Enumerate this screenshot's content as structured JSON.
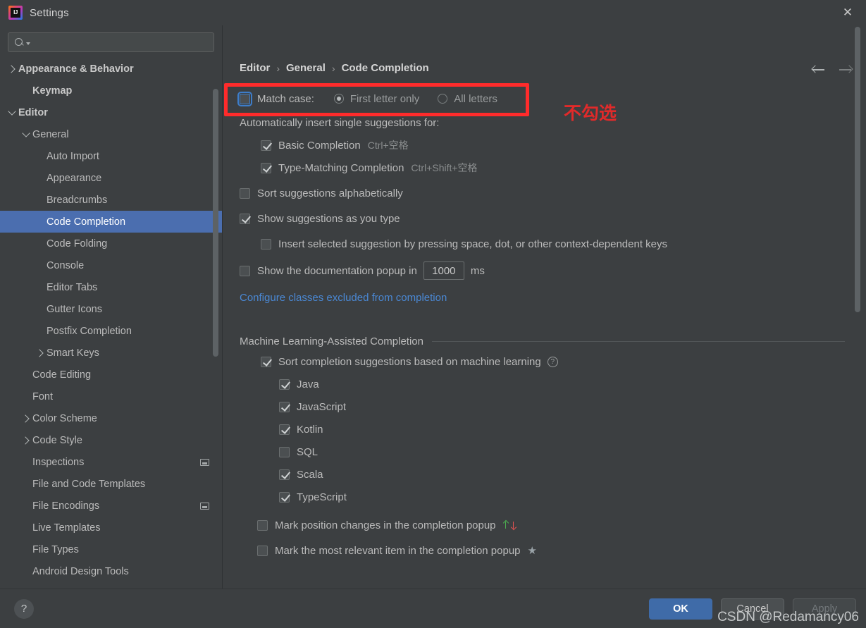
{
  "window": {
    "title": "Settings",
    "logo_icon": "intellij-idea-logo",
    "close_icon": "close-icon"
  },
  "sidebar": {
    "search": {
      "placeholder": "",
      "value": "",
      "icon": "search-icon",
      "caret_icon": "chevron-down-icon"
    },
    "items": [
      {
        "label": "Appearance & Behavior",
        "depth": 0,
        "twisty": "right",
        "bold": true,
        "selected": false,
        "trailing": false
      },
      {
        "label": "Keymap",
        "depth": 1,
        "twisty": "none",
        "bold": true,
        "selected": false,
        "trailing": false
      },
      {
        "label": "Editor",
        "depth": 0,
        "twisty": "down",
        "bold": true,
        "selected": false,
        "trailing": false
      },
      {
        "label": "General",
        "depth": 1,
        "twisty": "down",
        "bold": false,
        "selected": false,
        "trailing": false
      },
      {
        "label": "Auto Import",
        "depth": 2,
        "twisty": "none",
        "bold": false,
        "selected": false,
        "trailing": false
      },
      {
        "label": "Appearance",
        "depth": 2,
        "twisty": "none",
        "bold": false,
        "selected": false,
        "trailing": false
      },
      {
        "label": "Breadcrumbs",
        "depth": 2,
        "twisty": "none",
        "bold": false,
        "selected": false,
        "trailing": false
      },
      {
        "label": "Code Completion",
        "depth": 2,
        "twisty": "none",
        "bold": false,
        "selected": true,
        "trailing": false
      },
      {
        "label": "Code Folding",
        "depth": 2,
        "twisty": "none",
        "bold": false,
        "selected": false,
        "trailing": false
      },
      {
        "label": "Console",
        "depth": 2,
        "twisty": "none",
        "bold": false,
        "selected": false,
        "trailing": false
      },
      {
        "label": "Editor Tabs",
        "depth": 2,
        "twisty": "none",
        "bold": false,
        "selected": false,
        "trailing": false
      },
      {
        "label": "Gutter Icons",
        "depth": 2,
        "twisty": "none",
        "bold": false,
        "selected": false,
        "trailing": false
      },
      {
        "label": "Postfix Completion",
        "depth": 2,
        "twisty": "none",
        "bold": false,
        "selected": false,
        "trailing": false
      },
      {
        "label": "Smart Keys",
        "depth": 2,
        "twisty": "right",
        "bold": false,
        "selected": false,
        "trailing": false
      },
      {
        "label": "Code Editing",
        "depth": 1,
        "twisty": "none",
        "bold": false,
        "selected": false,
        "trailing": false
      },
      {
        "label": "Font",
        "depth": 1,
        "twisty": "none",
        "bold": false,
        "selected": false,
        "trailing": false
      },
      {
        "label": "Color Scheme",
        "depth": 1,
        "twisty": "right",
        "bold": false,
        "selected": false,
        "trailing": false
      },
      {
        "label": "Code Style",
        "depth": 1,
        "twisty": "right",
        "bold": false,
        "selected": false,
        "trailing": false
      },
      {
        "label": "Inspections",
        "depth": 1,
        "twisty": "none",
        "bold": false,
        "selected": false,
        "trailing": true
      },
      {
        "label": "File and Code Templates",
        "depth": 1,
        "twisty": "none",
        "bold": false,
        "selected": false,
        "trailing": false
      },
      {
        "label": "File Encodings",
        "depth": 1,
        "twisty": "none",
        "bold": false,
        "selected": false,
        "trailing": true
      },
      {
        "label": "Live Templates",
        "depth": 1,
        "twisty": "none",
        "bold": false,
        "selected": false,
        "trailing": false
      },
      {
        "label": "File Types",
        "depth": 1,
        "twisty": "none",
        "bold": false,
        "selected": false,
        "trailing": false
      },
      {
        "label": "Android Design Tools",
        "depth": 1,
        "twisty": "none",
        "bold": false,
        "selected": false,
        "trailing": false
      }
    ]
  },
  "breadcrumb": {
    "parts": [
      "Editor",
      "General",
      "Code Completion"
    ],
    "separator": "›",
    "back_icon": "arrow-left-icon",
    "forward_icon": "arrow-right-icon"
  },
  "content": {
    "match_case": {
      "label": "Match case:",
      "checked": false,
      "focused": true,
      "options": [
        {
          "label": "First letter only",
          "selected": true
        },
        {
          "label": "All letters",
          "selected": false
        }
      ]
    },
    "auto_insert_header": "Automatically insert single suggestions for:",
    "auto_insert_items": [
      {
        "label": "Basic Completion",
        "shortcut": "Ctrl+空格",
        "checked": true
      },
      {
        "label": "Type-Matching Completion",
        "shortcut": "Ctrl+Shift+空格",
        "checked": true
      }
    ],
    "sort_alphabetically": {
      "label": "Sort suggestions alphabetically",
      "checked": false
    },
    "show_as_you_type": {
      "label": "Show suggestions as you type",
      "checked": true
    },
    "insert_selected": {
      "label": "Insert selected suggestion by pressing space, dot, or other context-dependent keys",
      "checked": false
    },
    "doc_popup": {
      "label_before": "Show the documentation popup in",
      "value": "1000",
      "label_after": "ms",
      "checked": false
    },
    "excluded_link": "Configure classes excluded from completion",
    "ml_section": {
      "title": "Machine Learning-Assisted Completion",
      "sort_ml": {
        "label": "Sort completion suggestions based on machine learning",
        "checked": true,
        "help_icon": "help-circle-icon"
      },
      "languages": [
        {
          "label": "Java",
          "checked": true
        },
        {
          "label": "JavaScript",
          "checked": true
        },
        {
          "label": "Kotlin",
          "checked": true
        },
        {
          "label": "SQL",
          "checked": false
        },
        {
          "label": "Scala",
          "checked": true
        },
        {
          "label": "TypeScript",
          "checked": true
        }
      ],
      "mark_position": {
        "label": "Mark position changes in the completion popup",
        "checked": false,
        "icon": "up-down-arrows-icon"
      },
      "mark_relevant": {
        "label": "Mark the most relevant item in the completion popup",
        "checked": false,
        "icon": "star-icon"
      }
    }
  },
  "annotation": {
    "text": "不勾选",
    "color": "#e02a2a",
    "highlight_color": "#ff2b2b"
  },
  "footer": {
    "help_label": "?",
    "buttons": [
      {
        "label": "OK",
        "style": "primary"
      },
      {
        "label": "Cancel",
        "style": "normal"
      },
      {
        "label": "Apply",
        "style": "disabled"
      }
    ]
  },
  "watermark": "CSDN @Redamancy06"
}
